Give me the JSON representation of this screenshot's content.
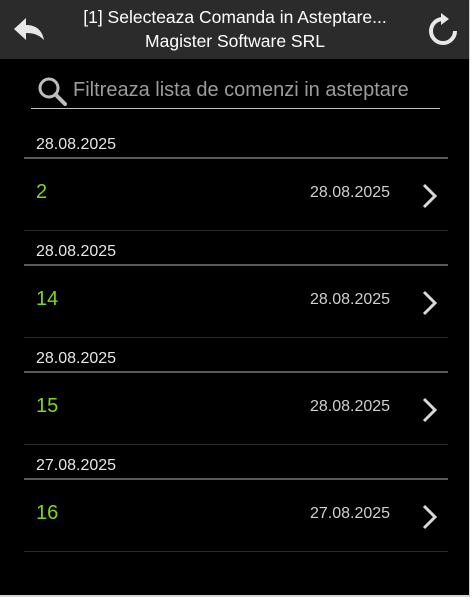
{
  "header": {
    "title_line1": "[1] Selecteaza Comanda in Asteptare...",
    "title_line2": "Magister Software SRL",
    "back_icon": "back-arrow-icon",
    "refresh_icon": "refresh-icon"
  },
  "search": {
    "placeholder": "Filtreaza lista de comenzi in asteptare",
    "value": "",
    "icon": "search-icon"
  },
  "groups": [
    {
      "header": "28.08.2025",
      "order": {
        "id": "2",
        "date": "28.08.2025"
      }
    },
    {
      "header": "28.08.2025",
      "order": {
        "id": "14",
        "date": "28.08.2025"
      }
    },
    {
      "header": "28.08.2025",
      "order": {
        "id": "15",
        "date": "28.08.2025"
      }
    },
    {
      "header": "27.08.2025",
      "order": {
        "id": "16",
        "date": "27.08.2025"
      }
    }
  ],
  "colors": {
    "header_bg": "#2b2b2b",
    "background": "#000000",
    "order_id": "#7fd61e",
    "date_text": "#cfcfcf"
  }
}
